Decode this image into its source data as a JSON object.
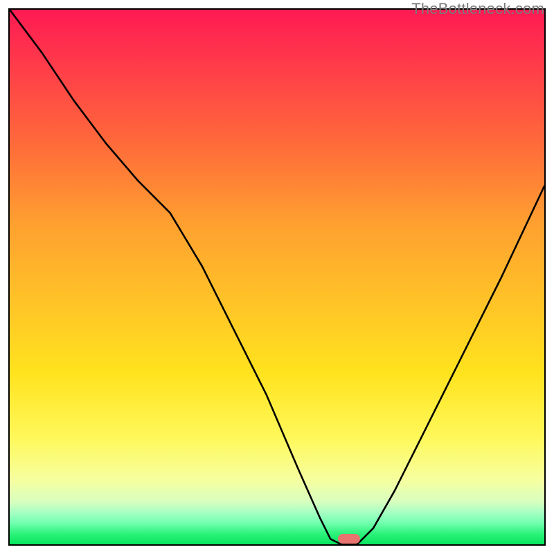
{
  "watermark": "TheBottleneck.com",
  "marker": {
    "x_pct": 63.5,
    "y_pct": 99.0
  },
  "chart_data": {
    "type": "line",
    "title": "",
    "xlabel": "",
    "ylabel": "",
    "xlim": [
      0,
      100
    ],
    "ylim": [
      0,
      100
    ],
    "grid": false,
    "legend": false,
    "series": [
      {
        "name": "bottleneck-curve",
        "x": [
          0,
          6,
          12,
          18,
          24,
          30,
          36,
          42,
          48,
          54,
          58,
          60,
          62,
          65,
          68,
          72,
          78,
          85,
          92,
          100
        ],
        "y": [
          100,
          92,
          83,
          75,
          68,
          62,
          52,
          40,
          28,
          14,
          5,
          1,
          0,
          0,
          3,
          10,
          22,
          36,
          50,
          67
        ]
      }
    ],
    "background_gradient": {
      "orientation": "vertical",
      "stops": [
        {
          "pos": 0.0,
          "color": "#ff1a53"
        },
        {
          "pos": 0.25,
          "color": "#ff6a3a"
        },
        {
          "pos": 0.55,
          "color": "#ffc427"
        },
        {
          "pos": 0.8,
          "color": "#fff85a"
        },
        {
          "pos": 0.94,
          "color": "#a8ffc4"
        },
        {
          "pos": 1.0,
          "color": "#07e65f"
        }
      ]
    },
    "marker_point": {
      "x": 63.5,
      "y": 0,
      "color": "#e8736f",
      "shape": "rounded-pill"
    }
  }
}
